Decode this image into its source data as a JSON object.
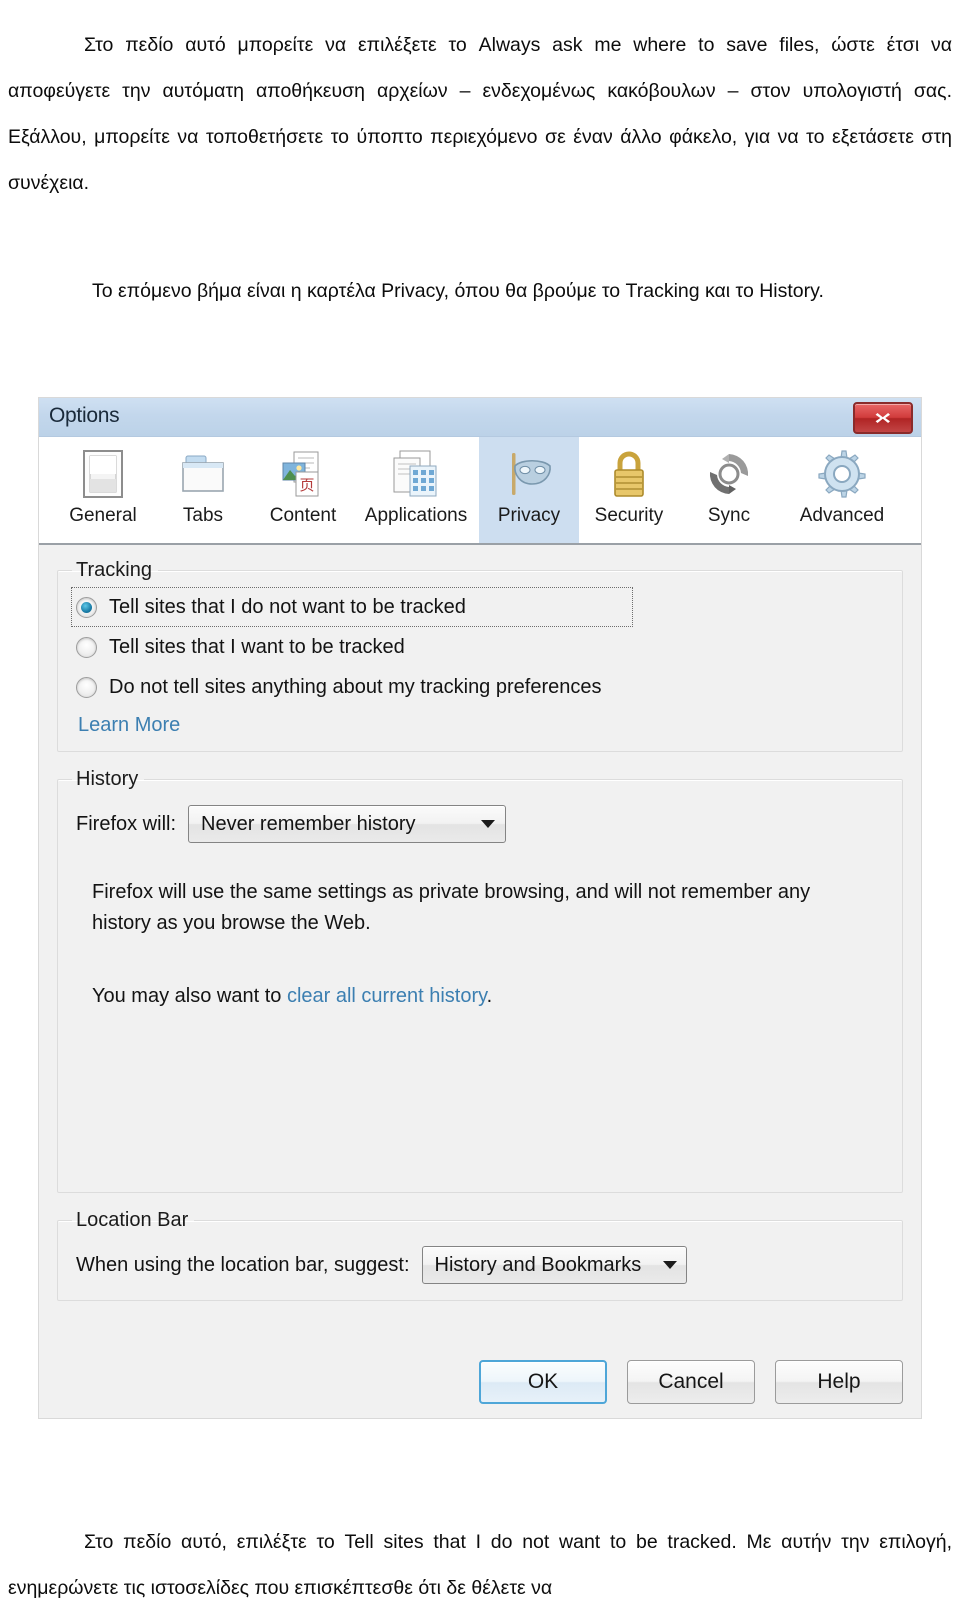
{
  "document": {
    "paragraph_top": "Στο πεδίο αυτό μπορείτε να επιλέξετε το Always ask me where to save files, ώστε έτσι να αποφεύγετε την αυτόματη αποθήκευση αρχείων – ενδεχομένως κακόβουλων – στον υπολογιστή σας. Εξάλλου, μπορείτε να τοποθετήσετε το ύποπτο περιεχόμενο σε έναν άλλο φάκελο, για να το εξετάσετε στη συνέχεια.",
    "paragraph_middle": "Το επόμενο βήμα είναι η καρτέλα Privacy, όπου θα βρούμε το Tracking και το History.",
    "paragraph_bottom": "Στο πεδίο αυτό, επιλέξτε το Tell sites that I do not want to be tracked. Με αυτήν την επιλογή, ενημερώνετε τις ιστοσελίδες που επισκέπτεσθε ότι δε θέλετε να"
  },
  "dialog": {
    "title": "Options",
    "close_icon": "close-x-icon",
    "tabs": [
      {
        "label": "General",
        "icon": "window-icon",
        "selected": false
      },
      {
        "label": "Tabs",
        "icon": "folder-tabs-icon",
        "selected": false
      },
      {
        "label": "Content",
        "icon": "content-page-icon",
        "selected": false
      },
      {
        "label": "Applications",
        "icon": "applications-icon",
        "selected": false
      },
      {
        "label": "Privacy",
        "icon": "mask-icon",
        "selected": true
      },
      {
        "label": "Security",
        "icon": "padlock-icon",
        "selected": false
      },
      {
        "label": "Sync",
        "icon": "sync-arrows-icon",
        "selected": false
      },
      {
        "label": "Advanced",
        "icon": "gear-icon",
        "selected": false
      }
    ],
    "tracking": {
      "legend": "Tracking",
      "options": [
        {
          "label": "Tell sites that I do not want to be tracked",
          "checked": true,
          "focused": true
        },
        {
          "label": "Tell sites that I want to be tracked",
          "checked": false,
          "focused": false
        },
        {
          "label": "Do not tell sites anything about my tracking preferences",
          "checked": false,
          "focused": false
        }
      ],
      "learn_more": "Learn More"
    },
    "history": {
      "legend": "History",
      "field_label": "Firefox will:",
      "selected_value": "Never remember history",
      "description": "Firefox will use the same settings as private browsing, and will not remember any history as you browse the Web.",
      "note_prefix": "You may also want to ",
      "note_link": "clear all current history",
      "note_suffix": "."
    },
    "location_bar": {
      "legend": "Location Bar",
      "field_label": "When using the location bar, suggest:",
      "selected_value": "History and Bookmarks"
    },
    "buttons": {
      "ok": "OK",
      "cancel": "Cancel",
      "help": "Help"
    }
  },
  "colors": {
    "titlebar": "#c3d7ec",
    "selected_tab": "#cddef0",
    "dialog_bg": "#f1f1f1",
    "link": "#3c7fb1",
    "close_red": "#c03030",
    "radio_dot": "#1b7ea8",
    "default_button_border": "#4ea6d8"
  }
}
